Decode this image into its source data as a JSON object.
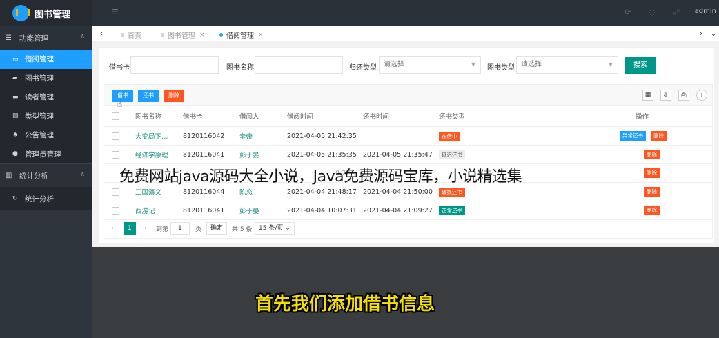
{
  "app": {
    "title": "图书管理",
    "user": "admin"
  },
  "sidebar": {
    "groups": [
      {
        "label": "功能管理",
        "items": [
          {
            "label": "借阅管理",
            "icon": "browser-icon",
            "active": true
          },
          {
            "label": "图书管理",
            "icon": "book-icon"
          },
          {
            "label": "读者管理",
            "icon": "card-icon"
          },
          {
            "label": "类型管理",
            "icon": "doc-icon"
          },
          {
            "label": "公告管理",
            "icon": "bell-icon"
          },
          {
            "label": "管理员管理",
            "icon": "user-icon"
          }
        ]
      },
      {
        "label": "统计分析",
        "items": [
          {
            "label": "统计分析",
            "icon": "refresh-icon"
          }
        ]
      }
    ]
  },
  "tabs": [
    {
      "label": "首页"
    },
    {
      "label": "图书管理",
      "close": "×"
    },
    {
      "label": "借阅管理",
      "close": "×",
      "active": true
    }
  ],
  "filters": {
    "card_label": "借书卡",
    "name_label": "图书名称",
    "return_type_label": "归还类型",
    "return_type_placeholder": "请选择",
    "book_type_label": "图书类型",
    "book_type_placeholder": "请选择",
    "search_label": "搜索"
  },
  "toolbar": {
    "borrow_label": "借书",
    "return_label": "还书",
    "delete_label": "删除",
    "colors": {
      "borrow": "#1e9fff",
      "return": "#1e9fff",
      "delete": "#ff5722"
    }
  },
  "table": {
    "headers": [
      "图书名称",
      "借书卡",
      "借阅人",
      "借阅时间",
      "还书时间",
      "还书类型",
      "操作"
    ],
    "rows": [
      {
        "name": "大变局下…",
        "card": "8120116042",
        "reader": "辛帝",
        "borrow_time": "2021-04-05 21:42:35",
        "return_time": "",
        "status": "在借中",
        "status_color": "#ff5722",
        "actions": [
          "异常还书",
          "删除"
        ]
      },
      {
        "name": "经济学原理",
        "card": "8120116041",
        "reader": "彭于晏",
        "borrow_time": "2021-04-05 21:35:35",
        "return_time": "2021-04-05 21:35:47",
        "status": "延迟还书",
        "status_color": "grey",
        "actions": [
          "删除"
        ]
      },
      {
        "name": "",
        "card": "",
        "reader": "",
        "borrow_time": "",
        "return_time": "0:22",
        "status": "",
        "status_color": "",
        "actions": [
          "删除"
        ]
      },
      {
        "name": "三国演义",
        "card": "8120116044",
        "reader": "陈恋",
        "borrow_time": "2021-04-04 21:48:17",
        "return_time": "2021-04-04 21:50:00",
        "status": "破损还书",
        "status_color": "#ff5722",
        "actions": [
          "删除"
        ]
      },
      {
        "name": "西游记",
        "card": "8120116041",
        "reader": "彭于晏",
        "borrow_time": "2021-04-04 10:07:31",
        "return_time": "2021-04-04 21:09:27",
        "status": "正常还书",
        "status_color": "#009688",
        "actions": [
          "删除"
        ]
      }
    ]
  },
  "pager": {
    "current": "1",
    "goto_label": "到第",
    "goto_value": "1",
    "page_unit": "页",
    "confirm_label": "确定",
    "total_label": "共 5 条",
    "page_size": "15 条/页"
  },
  "overlay_text": "免费网站java源码大全小说，Java免费源码宝库，小说精选集",
  "subtitle": "首先我们添加借书信息"
}
